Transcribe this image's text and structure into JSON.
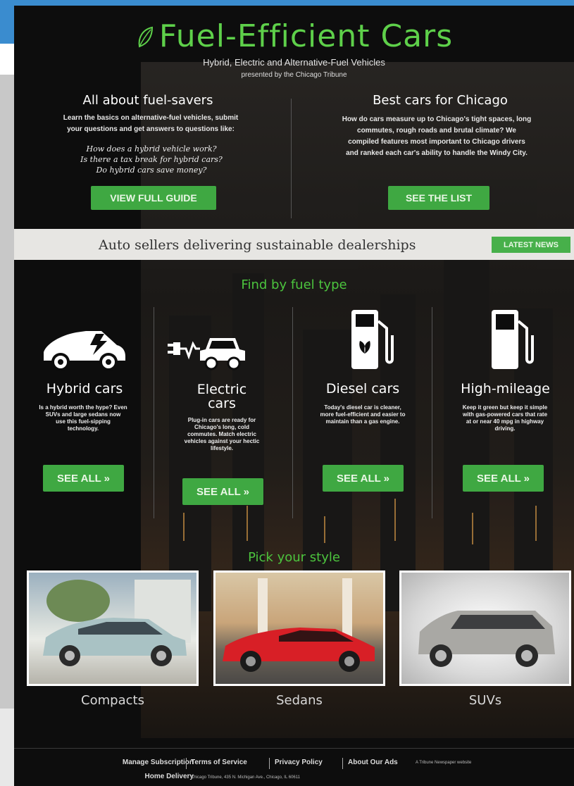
{
  "header": {
    "title": "Fuel-Efficient Cars",
    "subtitle": "Hybrid, Electric and Alternative-Fuel Vehicles",
    "presented_by": "presented by the Chicago Tribune"
  },
  "intro_left": {
    "heading": "All about fuel-savers",
    "text_line1": "Learn the basics on alternative-fuel vehicles, submit",
    "text_line2": "your questions and get answers to questions like:",
    "question1": "How does a hybrid vehicle work?",
    "question2": "Is there a tax break for hybrid cars?",
    "question3": "Do hybrid cars save money?",
    "button": "VIEW FULL GUIDE"
  },
  "intro_right": {
    "heading": "Best cars for Chicago",
    "text_line1": "How do cars measure up to Chicago's tight spaces, long",
    "text_line2": "commutes, rough roads and brutal climate? We",
    "text_line3": "compiled features most important to Chicago drivers",
    "text_line4": "and ranked each car's ability to handle the Windy City.",
    "button": "SEE THE LIST"
  },
  "news": {
    "headline": "Auto sellers delivering sustainable dealerships",
    "button": "LATEST NEWS"
  },
  "fuel_section": {
    "heading": "Find by fuel type",
    "types": [
      {
        "icon": "hybrid-car-icon",
        "name": "Hybrid cars",
        "desc1": "Is a hybrid worth the hype? Even",
        "desc2": "SUVs and large sedans now",
        "desc3": "use this fuel-sipping",
        "desc4": "technology.",
        "button": "SEE ALL »"
      },
      {
        "icon": "electric-car-icon",
        "name_line1": "Electric",
        "name_line2": "cars",
        "desc1": "Plug-in cars are ready for",
        "desc2": "Chicago's long, cold",
        "desc3": "commutes. Match electric",
        "desc4": "vehicles against your hectic",
        "desc5": "lifestyle.",
        "button": "SEE ALL »"
      },
      {
        "icon": "fuel-pump-leaf-icon",
        "name": "Diesel cars",
        "desc1": "Today's diesel car is cleaner,",
        "desc2": "more fuel-efficient and easier to",
        "desc3": "maintain than a gas engine.",
        "button": "SEE ALL »"
      },
      {
        "icon": "fuel-pump-icon",
        "name": "High-mileage",
        "desc1": "Keep it green but keep it simple",
        "desc2": "with gas-powered cars that rate",
        "desc3": "at or near 40 mpg in highway",
        "desc4": "driving.",
        "button": "SEE ALL »"
      }
    ]
  },
  "style_section": {
    "heading": "Pick your style",
    "items": [
      "Compacts",
      "Sedans",
      "SUVs"
    ]
  },
  "footer": {
    "manage": "Manage Subscription",
    "home_delivery": "Home Delivery",
    "terms": "Terms of Service",
    "privacy": "Privacy Policy",
    "about_ads": "About Our Ads",
    "tribune_site": "A Tribune Newspaper website",
    "address": "Chicago Tribune, 435 N. Michigan Ave., Chicago, IL 60611"
  },
  "colors": {
    "accent_green": "#4cc43e",
    "button_green": "#3fa842",
    "panel_bg": "#0d0d0d"
  }
}
